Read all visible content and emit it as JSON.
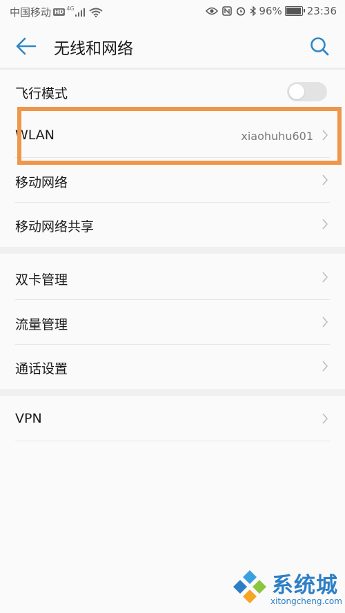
{
  "statusbar": {
    "carrier": "中国移动",
    "hd": "HD",
    "network": "4G",
    "battery": "96%",
    "time": "23:36"
  },
  "header": {
    "title": "无线和网络",
    "back_icon": "back-arrow-icon",
    "search_icon": "search-icon"
  },
  "colors": {
    "accent": "#2c87c8",
    "highlight": "#f0964a"
  },
  "items": [
    {
      "label": "飞行模式",
      "type": "toggle",
      "checked": false
    },
    {
      "label": "WLAN",
      "value": "xiaohuhu601"
    },
    {
      "label": "移动网络"
    },
    {
      "label": "移动网络共享"
    },
    {
      "label": "双卡管理"
    },
    {
      "label": "流量管理"
    },
    {
      "label": "通话设置"
    },
    {
      "label": "VPN"
    }
  ],
  "watermark": {
    "name": "系统城",
    "url": "xitongcheng.com"
  }
}
